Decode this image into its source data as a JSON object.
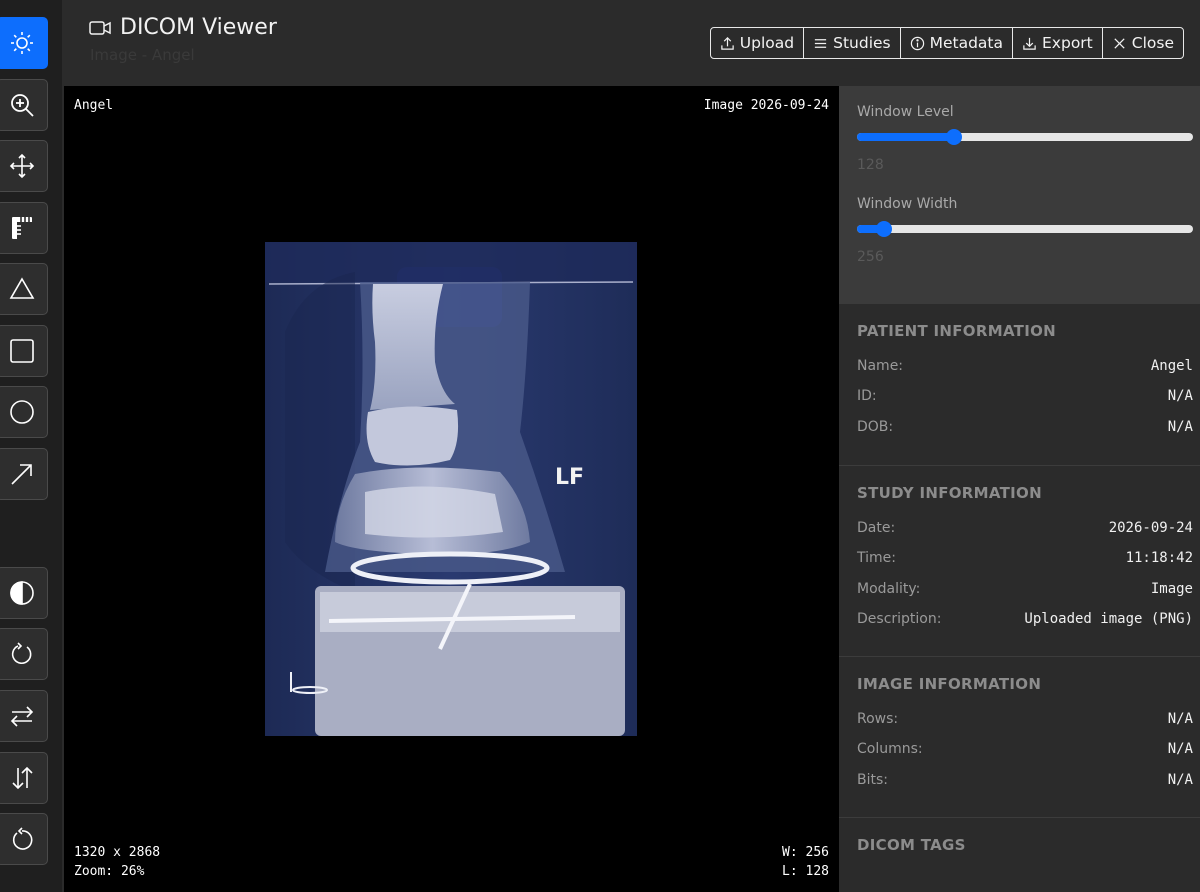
{
  "header": {
    "title": "DICOM Viewer",
    "subtitle": "Image - Angel",
    "buttons": {
      "upload": "Upload",
      "studies": "Studies",
      "metadata": "Metadata",
      "export": "Export",
      "close": "Close"
    }
  },
  "toolbar": {
    "tools": [
      "brightness-icon",
      "zoom-icon",
      "pan-icon",
      "ruler-icon",
      "angle-icon",
      "rectangle-icon",
      "ellipse-icon",
      "arrow-icon",
      "invert-icon",
      "rotate-icon",
      "flip-horizontal-icon",
      "flip-vertical-icon",
      "reset-icon"
    ],
    "active": "brightness-icon",
    "accent": "#0d6efd"
  },
  "viewport": {
    "top_left": "Angel",
    "top_right": "Image 2026-09-24",
    "dimensions": "1320 x 2868",
    "zoom": "Zoom: 26%",
    "window_width": "W: 256",
    "window_level": "L: 128"
  },
  "controls": {
    "window_level_label": "Window Level",
    "window_level_value": "128",
    "window_level_fraction": 0.29,
    "window_width_label": "Window Width",
    "window_width_value": "256",
    "window_width_fraction": 0.08
  },
  "patient": {
    "title": "PATIENT INFORMATION",
    "rows": [
      {
        "label": "Name:",
        "value": "Angel"
      },
      {
        "label": "ID:",
        "value": "N/A"
      },
      {
        "label": "DOB:",
        "value": "N/A"
      }
    ]
  },
  "study": {
    "title": "STUDY INFORMATION",
    "rows": [
      {
        "label": "Date:",
        "value": "2026-09-24"
      },
      {
        "label": "Time:",
        "value": "11:18:42"
      },
      {
        "label": "Modality:",
        "value": "Image"
      },
      {
        "label": "Description:",
        "value": "Uploaded image (PNG)"
      }
    ]
  },
  "image_info": {
    "title": "IMAGE INFORMATION",
    "rows": [
      {
        "label": "Rows:",
        "value": "N/A"
      },
      {
        "label": "Columns:",
        "value": "N/A"
      },
      {
        "label": "Bits:",
        "value": "N/A"
      }
    ]
  },
  "dicom_tags": {
    "title": "DICOM TAGS"
  },
  "xray": {
    "marker": "LF"
  }
}
